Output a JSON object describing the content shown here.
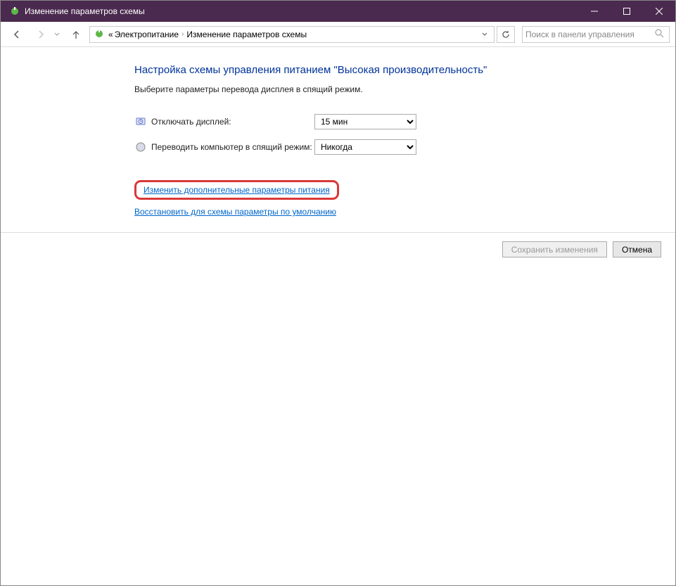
{
  "window": {
    "title": "Изменение параметров схемы"
  },
  "breadcrumb": {
    "prefix": "«",
    "item1": "Электропитание",
    "item2": "Изменение параметров схемы"
  },
  "search": {
    "placeholder": "Поиск в панели управления"
  },
  "page": {
    "heading": "Настройка схемы управления питанием \"Высокая производительность\"",
    "subhead": "Выберите параметры перевода дисплея в спящий режим."
  },
  "settings": {
    "display_off_label": "Отключать дисплей:",
    "display_off_value": "15 мин",
    "sleep_label": "Переводить компьютер в спящий режим:",
    "sleep_value": "Никогда"
  },
  "links": {
    "advanced": "Изменить дополнительные параметры питания",
    "restore": "Восстановить для схемы параметры по умолчанию"
  },
  "buttons": {
    "save": "Сохранить изменения",
    "cancel": "Отмена"
  }
}
